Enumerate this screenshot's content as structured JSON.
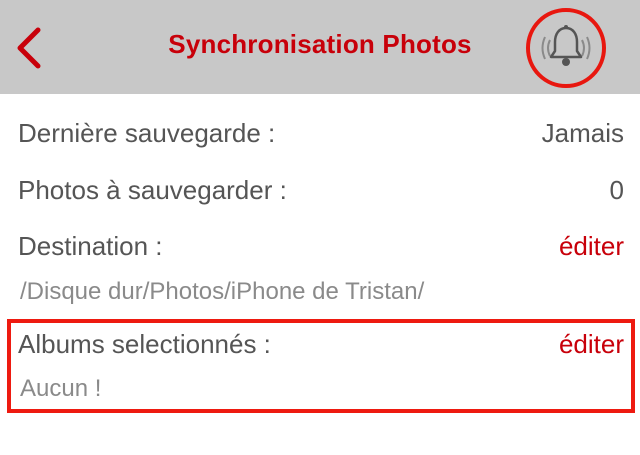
{
  "navbar": {
    "title": "Synchronisation Photos",
    "back_icon": "chevron-left-icon",
    "notification_icon": "bell-icon",
    "accent_color": "#c8000a",
    "background_color": "#c8c8c8"
  },
  "rows": {
    "last_backup": {
      "label": "Dernière sauvegarde :",
      "value": "Jamais"
    },
    "photos_to_backup": {
      "label": "Photos à sauvegarder :",
      "value": "0"
    },
    "destination": {
      "label": "Destination :",
      "action": "éditer",
      "path": "/Disque dur/Photos/iPhone de Tristan/"
    },
    "albums": {
      "label": "Albums selectionnés :",
      "action": "éditer",
      "value": "Aucun !"
    }
  },
  "highlight_color": "#ee1a10"
}
